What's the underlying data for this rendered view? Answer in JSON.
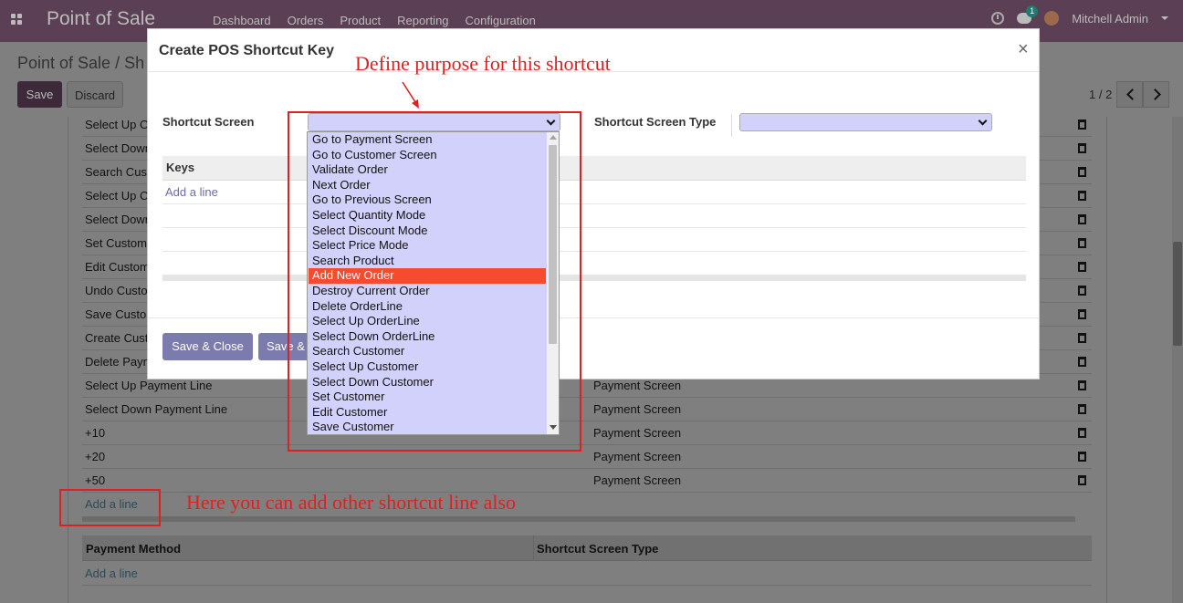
{
  "navbar": {
    "app_title": "Point of Sale",
    "menu": [
      "Dashboard",
      "Orders",
      "Product",
      "Reporting",
      "Configuration"
    ],
    "chat_count": "1",
    "user_name": "Mitchell Admin"
  },
  "control_panel": {
    "breadcrumb": "Point of Sale / Sh",
    "save_label": "Save",
    "discard_label": "Discard",
    "pager": "1 / 2"
  },
  "background_rows": [
    {
      "name": "Select Up O",
      "type": ""
    },
    {
      "name": "Select Down",
      "type": ""
    },
    {
      "name": "Search Cus",
      "type": ""
    },
    {
      "name": "Select Up C",
      "type": ""
    },
    {
      "name": "Select Down",
      "type": ""
    },
    {
      "name": "Set Custom",
      "type": ""
    },
    {
      "name": "Edit Custom",
      "type": ""
    },
    {
      "name": "Undo Custo",
      "type": ""
    },
    {
      "name": "Save Custo",
      "type": ""
    },
    {
      "name": "Create Cust",
      "type": ""
    },
    {
      "name": "Delete Payn",
      "type": ""
    },
    {
      "name": "Select Up Payment Line",
      "type": "Payment Screen"
    },
    {
      "name": "Select Down Payment Line",
      "type": "Payment Screen"
    },
    {
      "name": "+10",
      "type": "Payment Screen"
    },
    {
      "name": "+20",
      "type": "Payment Screen"
    },
    {
      "name": "+50",
      "type": "Payment Screen"
    }
  ],
  "background_add_line": "Add a line",
  "payment_table": {
    "col1": "Payment Method",
    "col2": "Shortcut Screen Type",
    "add_line": "Add a line"
  },
  "modal": {
    "title": "Create POS Shortcut Key",
    "close": "×",
    "shortcut_screen_label": "Shortcut Screen",
    "shortcut_screen_type_label": "Shortcut Screen Type",
    "keys_header": "Keys",
    "keys_add_line": "Add a line",
    "save_close_label": "Save & Close",
    "save_new_label": "Save &"
  },
  "dropdown": {
    "selected_index": 9,
    "options": [
      "Go to Payment Screen",
      "Go to Customer Screen",
      "Validate Order",
      "Next Order",
      "Go to Previous Screen",
      "Select Quantity Mode",
      "Select Discount Mode",
      "Select Price Mode",
      "Search Product",
      "Add New Order",
      "Destroy Current Order",
      "Delete OrderLine",
      "Select Up OrderLine",
      "Select Down OrderLine",
      "Search Customer",
      "Select Up Customer",
      "Select Down Customer",
      "Set Customer",
      "Edit Customer",
      "Save Customer"
    ]
  },
  "annotations": {
    "purpose_text": "Define purpose for this shortcut",
    "addline_text": "Here you can add other shortcut line also",
    "color": "#e02020"
  }
}
